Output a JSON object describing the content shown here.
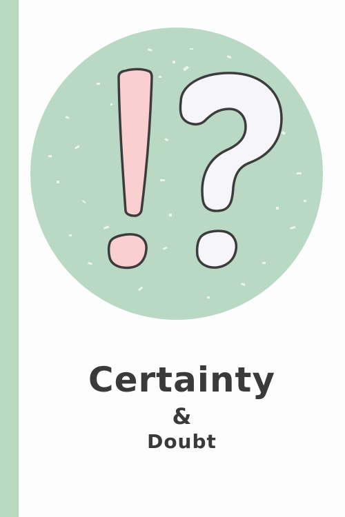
{
  "cover": {
    "title": "Certainty",
    "ampersand": "&",
    "subtitle": "Doubt",
    "icon": "interrobang-icon"
  },
  "colors": {
    "stripe": "#b8d8c0",
    "circle": "#b9d9c4",
    "exclamation_fill": "#f9cfd0",
    "question_fill": "#f6f5f9",
    "outline": "#3c3c3c",
    "text": "#3a3a3a",
    "background": "#fdfdfd"
  }
}
